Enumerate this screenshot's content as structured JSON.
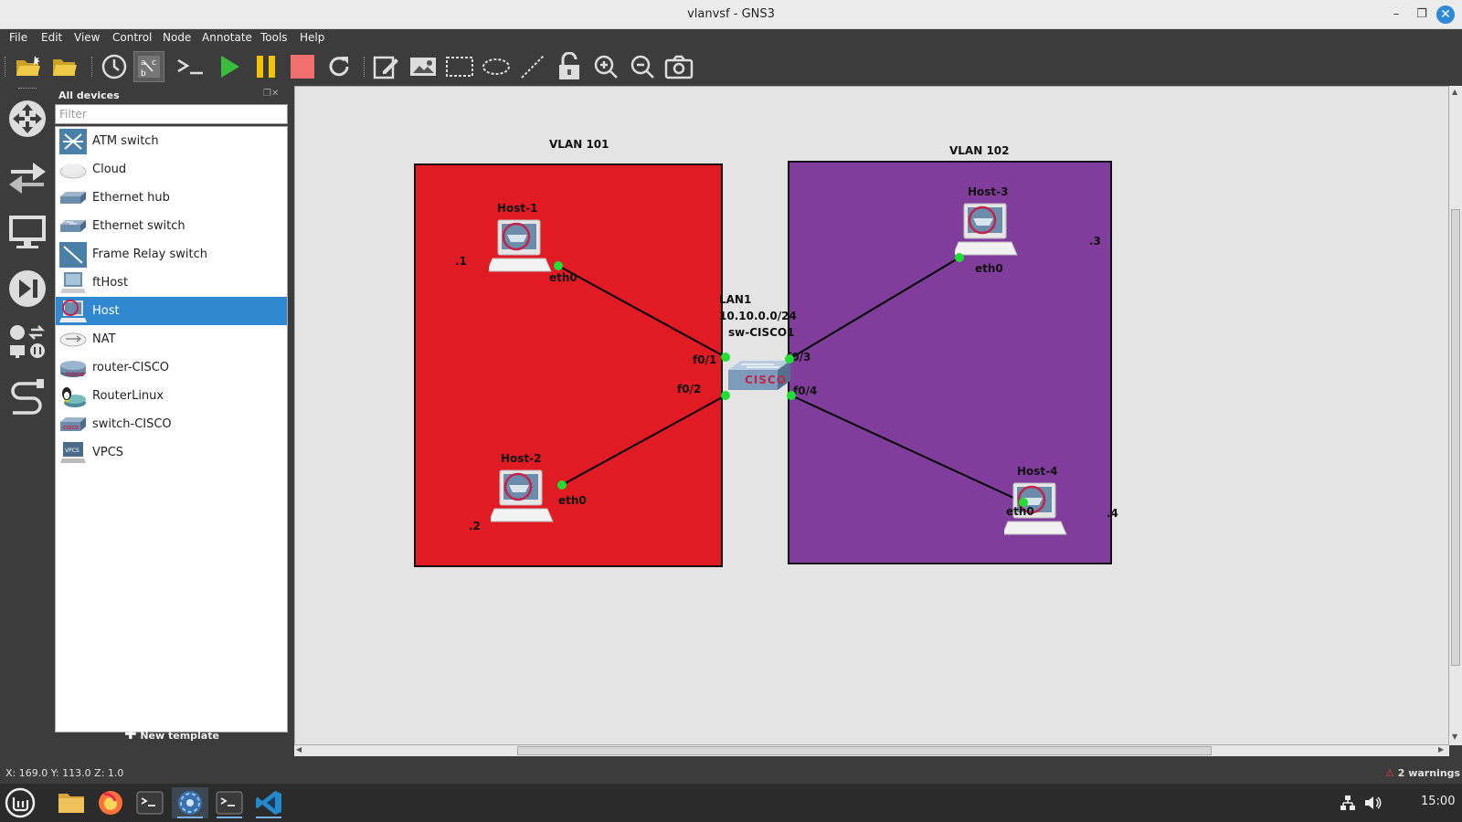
{
  "window": {
    "title": "vlanvsf - GNS3",
    "minimize": "–",
    "restore": "❐",
    "close": "✕"
  },
  "menu": [
    "File",
    "Edit",
    "View",
    "Control",
    "Node",
    "Annotate",
    "Tools",
    "Help"
  ],
  "toolbar_icons": [
    "new-project-icon",
    "open-project-icon",
    "snapshot-icon",
    "show-interface-labels-icon",
    "console-icon",
    "start-icon",
    "suspend-icon",
    "stop-icon",
    "reload-icon",
    "add-note-icon",
    "insert-picture-icon",
    "draw-rectangle-icon",
    "draw-ellipse-icon",
    "draw-line-icon",
    "lock-icon",
    "zoom-in-icon",
    "zoom-out-icon",
    "screenshot-icon"
  ],
  "device_panel": {
    "title": "All devices",
    "filter_placeholder": "Filter",
    "new_template": "New template",
    "devices": [
      {
        "label": "ATM switch",
        "icon": "atm-switch-icon"
      },
      {
        "label": "Cloud",
        "icon": "cloud-icon"
      },
      {
        "label": "Ethernet hub",
        "icon": "ethernet-hub-icon"
      },
      {
        "label": "Ethernet switch",
        "icon": "ethernet-switch-icon"
      },
      {
        "label": "Frame Relay switch",
        "icon": "frame-relay-switch-icon"
      },
      {
        "label": "ftHost",
        "icon": "fthost-icon"
      },
      {
        "label": "Host",
        "icon": "host-icon",
        "selected": true
      },
      {
        "label": "NAT",
        "icon": "nat-icon"
      },
      {
        "label": "router-CISCO",
        "icon": "router-cisco-icon"
      },
      {
        "label": "RouterLinux",
        "icon": "router-linux-icon"
      },
      {
        "label": "switch-CISCO",
        "icon": "switch-cisco-icon"
      },
      {
        "label": "VPCS",
        "icon": "vpcs-icon"
      }
    ]
  },
  "topology": {
    "vlan101": {
      "label": "VLAN 101",
      "color": "#e01b24"
    },
    "vlan102": {
      "label": "VLAN 102",
      "color": "#813d9c"
    },
    "switch": {
      "name": "sw-CISCO1",
      "lan_name": "LAN1",
      "subnet": "10.10.0.0/24",
      "logo": "CISCO"
    },
    "hosts": [
      {
        "name": "Host-1",
        "ip_suffix": ".1",
        "iface": "eth0",
        "switch_port": "f0/1"
      },
      {
        "name": "Host-2",
        "ip_suffix": ".2",
        "iface": "eth0",
        "switch_port": "f0/2"
      },
      {
        "name": "Host-3",
        "ip_suffix": ".3",
        "iface": "eth0",
        "switch_port": "f0/3"
      },
      {
        "name": "Host-4",
        "ip_suffix": ".4",
        "iface": "eth0",
        "switch_port": "f0/4"
      }
    ]
  },
  "status": {
    "coords": "X: 169.0 Y: 113.0 Z: 1.0",
    "warnings": "2 warnings"
  },
  "taskbar": {
    "apps": [
      "mint-menu-icon",
      "files-icon",
      "firefox-icon",
      "terminal-icon",
      "gns3-icon",
      "terminal-icon",
      "vscode-icon"
    ],
    "clock": "15:00"
  }
}
